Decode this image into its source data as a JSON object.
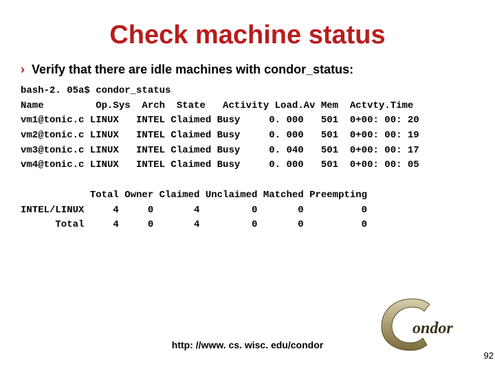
{
  "title": "Check machine status",
  "bullet": {
    "marker": "›",
    "text": "Verify that there are idle machines with condor_status:"
  },
  "prompt": "bash-2. 05a$ condor_status",
  "headers": "Name         Op.Sys  Arch  State   Activity Load.Av Mem  Actvty.Time",
  "rows": [
    "vm1@tonic.c LINUX   INTEL Claimed Busy     0. 000   501  0+00: 00: 20",
    "vm2@tonic.c LINUX   INTEL Claimed Busy     0. 000   501  0+00: 00: 19",
    "vm3@tonic.c LINUX   INTEL Claimed Busy     0. 040   501  0+00: 00: 17",
    "vm4@tonic.c LINUX   INTEL Claimed Busy     0. 000   501  0+00: 00: 05"
  ],
  "summary_header": "            Total Owner Claimed Unclaimed Matched Preempting",
  "summary_rows": [
    "INTEL/LINUX     4     0       4         0       0          0",
    "      Total     4     0       4         0       0          0"
  ],
  "footer_url": "http: //www. cs. wisc. edu/condor",
  "page_number": "92",
  "logo_label": "Condor"
}
